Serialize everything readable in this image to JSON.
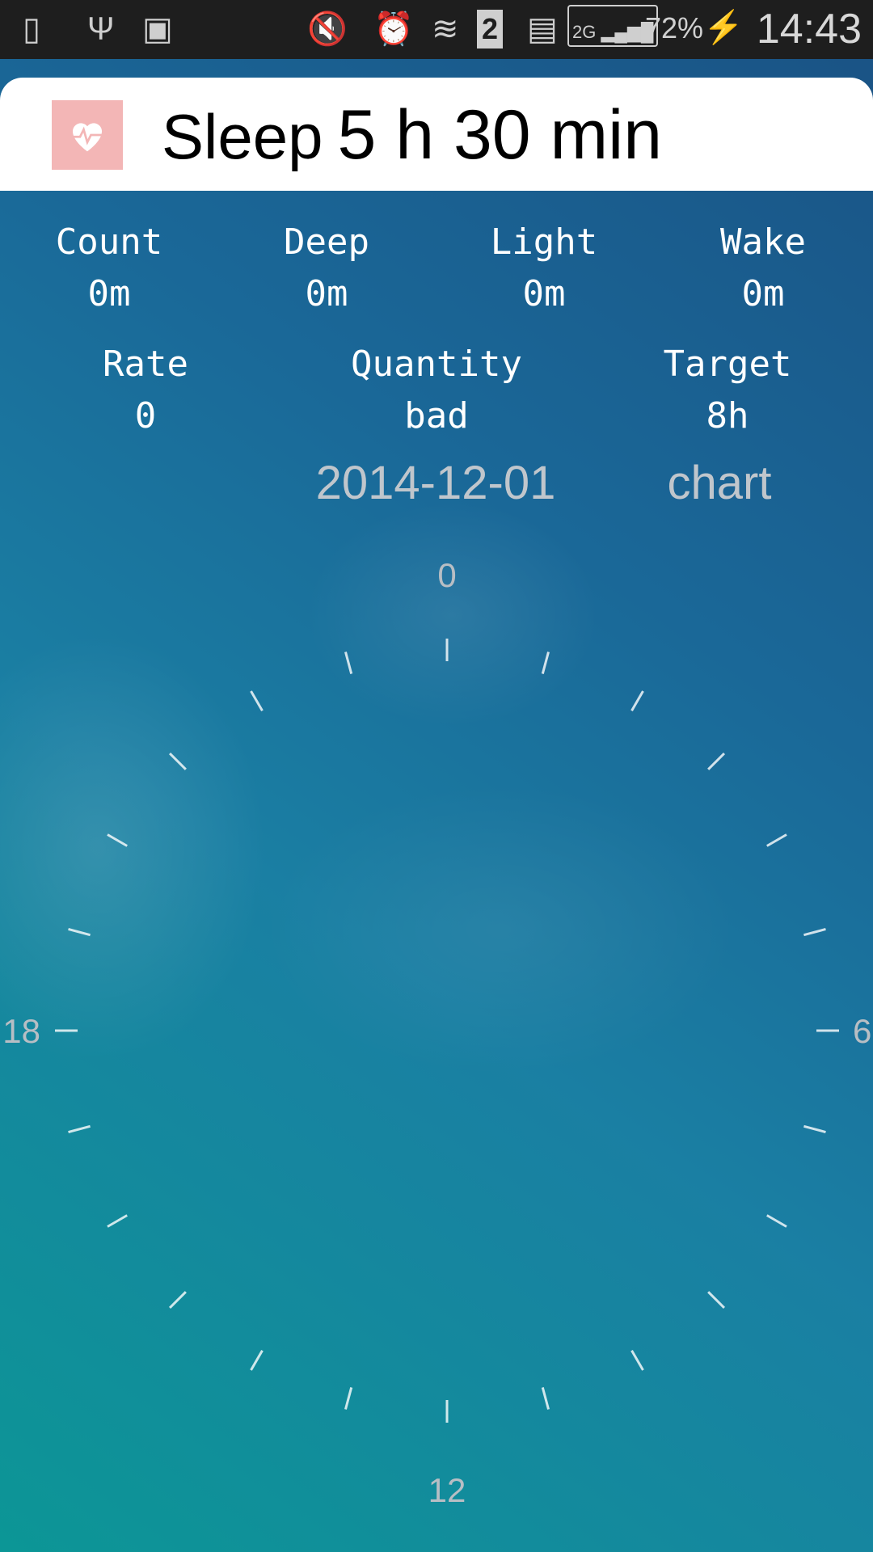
{
  "status_bar": {
    "icons": [
      "screenshot-icon",
      "usb-icon",
      "gallery-icon",
      "mute-vibrate-icon",
      "alarm-icon",
      "wifi-icon",
      "sim2-icon",
      "sim-card-icon",
      "signal-2g-icon",
      "battery-charging-icon"
    ],
    "sim_slot": "2",
    "network": "2G",
    "battery": "72%",
    "time": "14:43"
  },
  "header": {
    "icon": "heart-pulse-icon",
    "label": "Sleep",
    "value": "5 h 30 min",
    "icon_color": "#f3b6b6"
  },
  "stats_row1": [
    {
      "label": "Count",
      "value": "0m"
    },
    {
      "label": "Deep",
      "value": "0m"
    },
    {
      "label": "Light",
      "value": "0m"
    },
    {
      "label": "Wake",
      "value": "0m"
    }
  ],
  "stats_row2": [
    {
      "label": "Rate",
      "value": "0"
    },
    {
      "label": "Quantity",
      "value": "bad"
    },
    {
      "label": "Target",
      "value": "8h"
    }
  ],
  "date": "2014-12-01",
  "chart_link": "chart",
  "clock": {
    "labels": {
      "top": "0",
      "right": "6",
      "bottom": "12",
      "left": "18"
    },
    "ticks": 24
  }
}
